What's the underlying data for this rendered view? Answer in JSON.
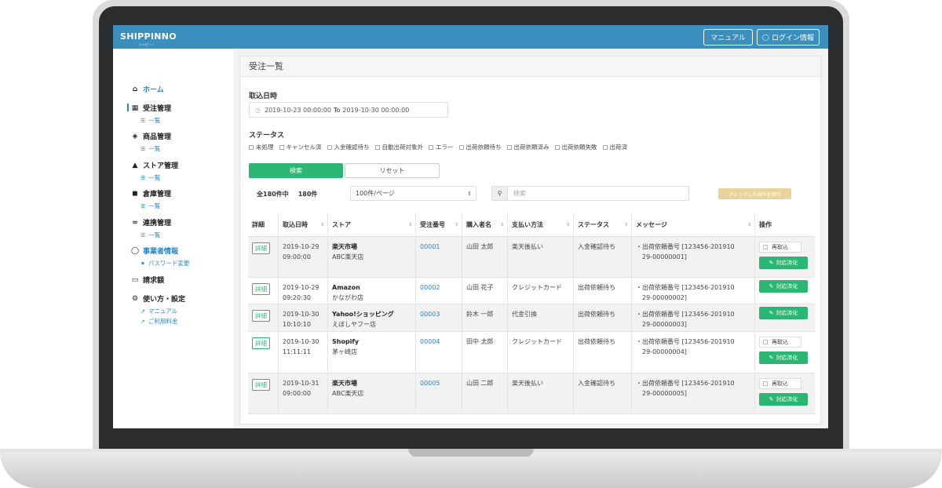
{
  "app": {
    "logo": "SHIPPINNO",
    "logo_sub": "シッピーノ",
    "header_buttons": {
      "manual": "マニュアル",
      "login": "ログイン情報"
    }
  },
  "sidebar": {
    "home": "ホーム",
    "orders": "受注管理",
    "orders_list": "一覧",
    "products": "商品管理",
    "products_list": "一覧",
    "stores": "ストア管理",
    "stores_list": "一覧",
    "warehouse": "倉庫管理",
    "warehouse_list": "一覧",
    "integration": "連携管理",
    "integration_list": "一覧",
    "business": "事業者情報",
    "password": "パスワード変更",
    "billing": "請求額",
    "settings": "使い方・設定",
    "manual": "マニュアル",
    "pricing": "ご利用料金"
  },
  "main": {
    "title": "受注一覧",
    "import_date_label": "取込日時",
    "date_from": "2019-10-23 00:00:00",
    "date_to_label": "To",
    "date_to": "2019-10-30 00:00:00",
    "status_label": "ステータス",
    "statuses": [
      "未処理",
      "キャンセル済",
      "入金確認待ち",
      "自動出荷対象外",
      "エラー",
      "出荷依頼待ち",
      "出荷依頼済み",
      "出荷依頼失敗",
      "出荷済"
    ],
    "search_button": "検索",
    "reset_button": "リセット",
    "total_count": "全180件中",
    "shown_count": "180件",
    "per_page": "100件/ページ",
    "search_placeholder": "検索",
    "bulk_action": "チェックした操作を実行"
  },
  "table": {
    "headers": [
      "詳細",
      "取込日時",
      "ストア",
      "受注番号",
      "購入者名",
      "支払い方法",
      "ステータス",
      "メッセージ",
      "操作"
    ],
    "detail_label": "詳細",
    "reimport_label": "再取込",
    "done_label": "対応済化",
    "rows": [
      {
        "date": "2019-10-29",
        "time": "09:00:00",
        "store": "楽天市場",
        "shop": "ABC楽天店",
        "order_no": "00001",
        "buyer": "山田 太郎",
        "payment": "楽天後払い",
        "status": "入金確認待ち",
        "msg1": "・出荷依頼番号 [123456-201910",
        "msg2": "29-00000001]",
        "reimport": true
      },
      {
        "date": "2019-10-29",
        "time": "09:20:30",
        "store": "Amazon",
        "shop": "かながわ店",
        "order_no": "00002",
        "buyer": "山田 花子",
        "payment": "クレジットカード",
        "status": "出荷依頼待ち",
        "msg1": "・出荷依頼番号 [123456-201910",
        "msg2": "29-00000002]",
        "reimport": false
      },
      {
        "date": "2019-10-30",
        "time": "10:10:10",
        "store": "Yahoo!ショッピング",
        "shop": "えぼしヤフー店",
        "order_no": "00003",
        "buyer": "鈴木 一郎",
        "payment": "代金引換",
        "status": "出荷依頼待ち",
        "msg1": "・出荷依頼番号 [123456-201910",
        "msg2": "29-00000003]",
        "reimport": false
      },
      {
        "date": "2019-10-30",
        "time": "11:11:11",
        "store": "Shopify",
        "shop": "茅ヶ崎店",
        "order_no": "00004",
        "buyer": "田中 太郎",
        "payment": "クレジットカード",
        "status": "出荷依頼待ち",
        "msg1": "・出荷依頼番号 [123456-201910",
        "msg2": "29-00000004]",
        "reimport": true
      },
      {
        "date": "2019-10-31",
        "time": "09:00:00",
        "store": "楽天市場",
        "shop": "ABC楽天店",
        "order_no": "00005",
        "buyer": "山田 二郎",
        "payment": "楽天後払い",
        "status": "入金確認待ち",
        "msg1": "・出荷依頼番号 [123456-201910",
        "msg2": "29-00000005]",
        "reimport": true
      }
    ]
  },
  "colors": {
    "header": "#3a8fbe",
    "accent": "#2bb673",
    "link": "#2b86c5",
    "bulk": "#e8d49a"
  }
}
